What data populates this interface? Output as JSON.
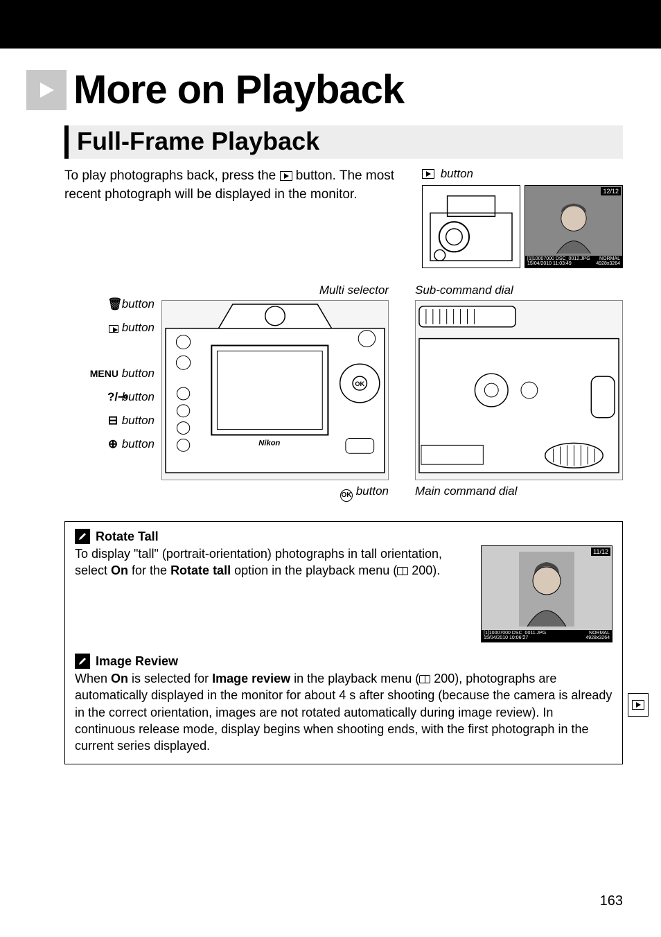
{
  "chapter_title": "More on Playback",
  "section_title": "Full-Frame Playback",
  "intro": {
    "pre": "To play photographs back, press the ",
    "post": " button. The most recent photograph will be displayed in the monitor.",
    "fig_label_suffix": " button"
  },
  "diagram": {
    "multi_selector": "Multi selector",
    "sub_command_dial": "Sub-command dial",
    "labels": {
      "delete": " button",
      "playback": " button",
      "menu_prefix": "MENU",
      "menu": " button",
      "help": " button",
      "thumb": " button",
      "zoom": " button"
    },
    "ok_button": " button",
    "main_command_dial": "Main command dial"
  },
  "thumbs": {
    "counter1": "12/12",
    "info_left1": "[1]10007000 DSC_0012.JPG",
    "info_left2": "15/04/2010 11:03:49",
    "info_right1": "NORMAL",
    "info_right2": "4928x3264",
    "counter2": "11/12",
    "info2_left1": "[1]10007000 DSC_0011.JPG",
    "info2_left2": "15/04/2010 10:06:27"
  },
  "tip1": {
    "title": "Rotate Tall",
    "t1": "To display \"tall\" (portrait-orientation) photographs in tall orientation, select ",
    "b1": "On",
    "t2": " for the ",
    "b2": "Rotate tall",
    "t3": " option in the playback menu (",
    "pg": " 200).",
    "end": ""
  },
  "tip2": {
    "title": "Image Review",
    "t1": "When ",
    "b1": "On",
    "t2": " is selected for ",
    "b2": "Image review",
    "t3": " in the playback menu (",
    "pg": " 200), photographs are automatically displayed in the monitor for about 4 s after shooting (because the camera is already in the correct orientation, images are not rotated automatically during image review).  In continuous release mode, display begins when shooting ends, with the first photograph in the current series displayed."
  },
  "page_number": "163"
}
